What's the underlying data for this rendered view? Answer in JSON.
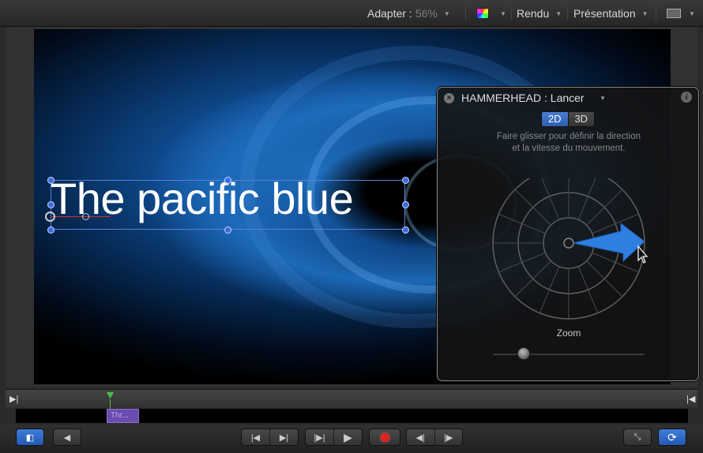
{
  "toolbar": {
    "zoom_label": "Adapter :",
    "zoom_value": "56%",
    "render_label": "Rendu",
    "view_label": "Présentation"
  },
  "canvas": {
    "text": "The pacific blue"
  },
  "hud": {
    "title": "HAMMERHEAD : Lancer",
    "mode_2d": "2D",
    "mode_3d": "3D",
    "active_mode": "2D",
    "description_line1": "Faire glisser pour définir la direction",
    "description_line2": "et la vitesse du mouvement.",
    "zoom_label": "Zoom",
    "zoom_slider_fraction": 0.2
  },
  "timeline": {
    "clip_label": "Thr..."
  },
  "colors": {
    "accent_blue": "#2f5fae",
    "arrow_blue": "#2f7fe0",
    "clip_purple": "#6a4bb0",
    "record_red": "#dd2222"
  },
  "icons": {
    "close": "close-icon",
    "info": "info-icon",
    "direction": "arrow-icon",
    "cursor": "pointer-cursor-icon"
  }
}
